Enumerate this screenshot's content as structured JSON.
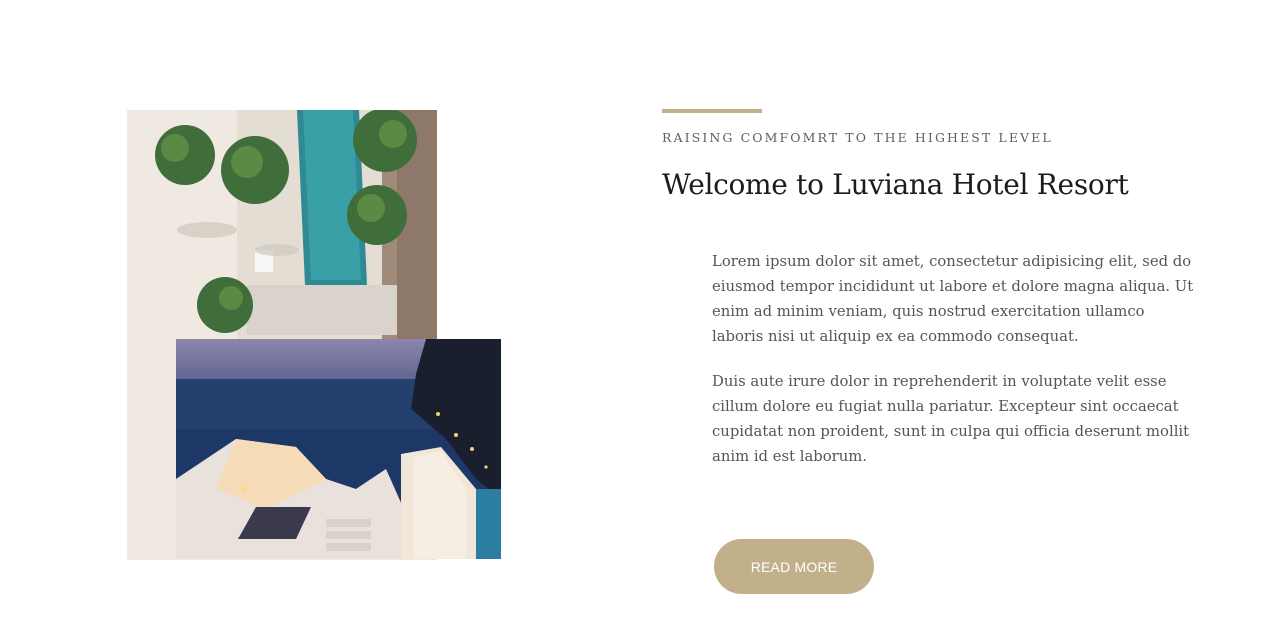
{
  "about": {
    "eyebrow": "RAISING COMFOMRT TO THE HIGHEST LEVEL",
    "title": "Welcome to Luviana Hotel Resort",
    "paragraphs": [
      "Lorem ipsum dolor sit amet, consectetur adipisicing elit, sed do eiusmod tempor incididunt ut labore et dolore magna aliqua. Ut enim ad minim veniam, quis nostrud exercitation ullamco laboris nisi ut aliquip ex ea commodo consequat.",
      "Duis aute irure dolor in reprehenderit in voluptate velit esse cillum dolore eu fugiat nulla pariatur. Excepteur sint occaecat cupidatat non proident, sunt in culpa qui officia deserunt mollit anim id est laborum."
    ],
    "button_label": "READ MORE"
  },
  "images": {
    "back_photo": "aerial-pool-palms",
    "front_photo": "seaside-terrace-dusk"
  },
  "colors": {
    "accent": "#c2b08a",
    "heading": "#1c1c1c",
    "body": "#555555"
  }
}
